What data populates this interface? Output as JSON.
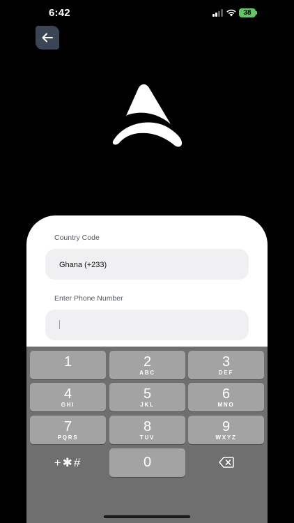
{
  "status_bar": {
    "time": "6:42",
    "battery": "38"
  },
  "icons": {
    "back": "arrow-left-icon",
    "logo": "app-logo",
    "delete": "backspace-icon"
  },
  "form": {
    "country_label": "Country Code",
    "country_value": "Ghana (+233)",
    "phone_label": "Enter Phone Number",
    "phone_value": ""
  },
  "keyboard": {
    "keys": [
      {
        "digit": "1",
        "letters": ""
      },
      {
        "digit": "2",
        "letters": "ABC"
      },
      {
        "digit": "3",
        "letters": "DEF"
      },
      {
        "digit": "4",
        "letters": "GHI"
      },
      {
        "digit": "5",
        "letters": "JKL"
      },
      {
        "digit": "6",
        "letters": "MNO"
      },
      {
        "digit": "7",
        "letters": "PQRS"
      },
      {
        "digit": "8",
        "letters": "TUV"
      },
      {
        "digit": "9",
        "letters": "WXYZ"
      }
    ],
    "symbols": "+✱#",
    "zero": "0"
  },
  "colors": {
    "background": "#000000",
    "back_button": "#3c4553",
    "battery": "#65c466",
    "keyboard": "#6f6f6f",
    "key": "#a3a3a3"
  }
}
